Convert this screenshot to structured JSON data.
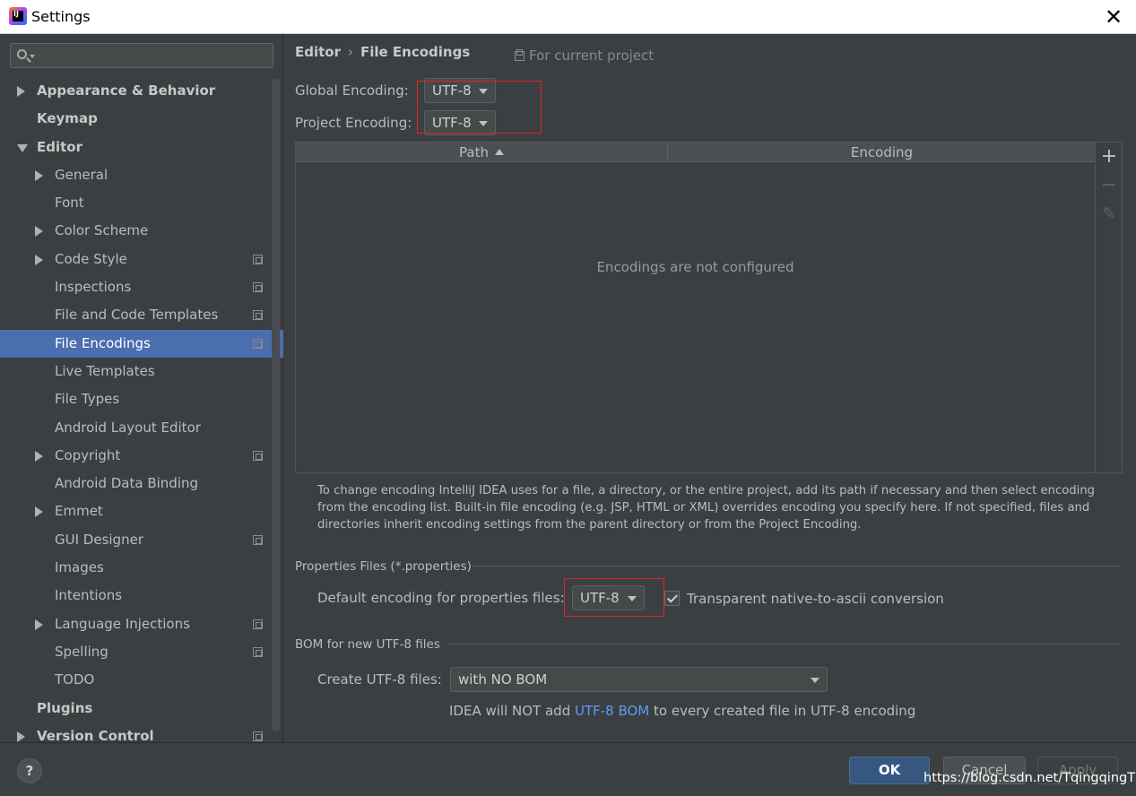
{
  "window": {
    "title": "Settings",
    "close_glyph": "✕"
  },
  "sidebar": {
    "search_placeholder": "",
    "items": [
      {
        "label": "Appearance & Behavior",
        "level": 0,
        "expander": "collapsed"
      },
      {
        "label": "Keymap",
        "level": 0,
        "expander": "none"
      },
      {
        "label": "Editor",
        "level": 0,
        "expander": "expanded"
      },
      {
        "label": "General",
        "level": 1,
        "expander": "collapsed"
      },
      {
        "label": "Font",
        "level": 1,
        "expander": "none"
      },
      {
        "label": "Color Scheme",
        "level": 1,
        "expander": "collapsed"
      },
      {
        "label": "Code Style",
        "level": 1,
        "expander": "collapsed",
        "project_icon": true
      },
      {
        "label": "Inspections",
        "level": 1,
        "expander": "none",
        "project_icon": true
      },
      {
        "label": "File and Code Templates",
        "level": 1,
        "expander": "none",
        "project_icon": true
      },
      {
        "label": "File Encodings",
        "level": 1,
        "expander": "none",
        "project_icon": true,
        "selected": true
      },
      {
        "label": "Live Templates",
        "level": 1,
        "expander": "none"
      },
      {
        "label": "File Types",
        "level": 1,
        "expander": "none"
      },
      {
        "label": "Android Layout Editor",
        "level": 1,
        "expander": "none"
      },
      {
        "label": "Copyright",
        "level": 1,
        "expander": "collapsed",
        "project_icon": true
      },
      {
        "label": "Android Data Binding",
        "level": 1,
        "expander": "none"
      },
      {
        "label": "Emmet",
        "level": 1,
        "expander": "collapsed"
      },
      {
        "label": "GUI Designer",
        "level": 1,
        "expander": "none",
        "project_icon": true
      },
      {
        "label": "Images",
        "level": 1,
        "expander": "none"
      },
      {
        "label": "Intentions",
        "level": 1,
        "expander": "none"
      },
      {
        "label": "Language Injections",
        "level": 1,
        "expander": "collapsed",
        "project_icon": true
      },
      {
        "label": "Spelling",
        "level": 1,
        "expander": "none",
        "project_icon": true
      },
      {
        "label": "TODO",
        "level": 1,
        "expander": "none"
      },
      {
        "label": "Plugins",
        "level": 0,
        "expander": "none"
      },
      {
        "label": "Version Control",
        "level": 0,
        "expander": "collapsed",
        "project_icon": true
      }
    ]
  },
  "main": {
    "breadcrumb": {
      "parent": "Editor",
      "separator": "›",
      "current": "File Encodings"
    },
    "scope_note": "For current project",
    "global_encoding": {
      "label": "Global Encoding:",
      "value": "UTF-8"
    },
    "project_encoding": {
      "label": "Project Encoding:",
      "value": "UTF-8"
    },
    "table": {
      "columns": [
        "Path",
        "Encoding"
      ],
      "sorted_column": "Path",
      "sort_direction": "ascending",
      "empty_text": "Encodings are not configured",
      "tools": {
        "add": "+",
        "remove": "−",
        "edit": "✎"
      }
    },
    "description": "To change encoding IntelliJ IDEA uses for a file, a directory, or the entire project, add its path if necessary and then select encoding from the encoding list. Built-in file encoding (e.g. JSP, HTML or XML) overrides encoding you specify here. If not specified, files and directories inherit encoding settings from the parent directory or from the Project Encoding.",
    "properties": {
      "section_title": "Properties Files (*.properties)",
      "default_label": "Default encoding for properties files:",
      "default_value": "UTF-8",
      "native_to_ascii_label": "Transparent native-to-ascii conversion",
      "native_to_ascii_checked": true
    },
    "bom": {
      "section_title": "BOM for new UTF-8 files",
      "create_label": "Create UTF-8 files:",
      "create_value": "with NO BOM",
      "note_prefix": "IDEA will NOT add ",
      "note_link": "UTF-8 BOM",
      "note_suffix": " to every created file in UTF-8 encoding"
    }
  },
  "footer": {
    "help": "?",
    "ok": "OK",
    "cancel": "Cancel",
    "apply": "Apply",
    "watermark": "https://blog.csdn.net/TqingqingT"
  },
  "colors": {
    "accent_selection": "#4b6eaf",
    "ok_button": "#365880",
    "link": "#589df6",
    "highlight_box": "#e0242b",
    "background": "#3c3f41"
  }
}
